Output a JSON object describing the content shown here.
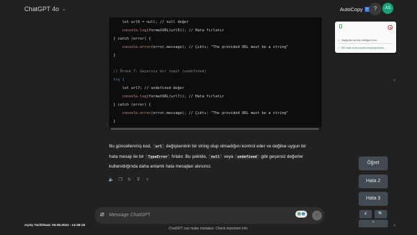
{
  "header": {
    "model_label": "ChatGPT 4o",
    "autocopy_label": "AutoCopy",
    "help_label": "?",
    "avatar_initials": "AS"
  },
  "popup": {
    "item1": "Aşağıda vermiş olduğun kod...",
    "item2": "Bir hata durumunda karşılaşılacak..."
  },
  "code": {
    "l1": "    let url6 = null; // null değer",
    "l2a": "    console",
    "l2b": ".log",
    "l2c": "(formatURL(url6)); // Hata fırlatır",
    "l3": "} catch (error) {",
    "l4a": "    console",
    "l4b": ".error",
    "l4c": "(error.message); // Çıktı: \"The provided URL must be a string\"",
    "l5": "}",
    "l6": "// Örnek 7: Geçersiz bir input (undefined)",
    "l7": "try {",
    "l8": "    let url7; // undefined değer",
    "l9a": "    console",
    "l9b": ".log",
    "l9c": "(formatURL(url7)); // Hata fırlatır",
    "l10": "} catch (error) {",
    "l11a": "    console",
    "l11b": ".error",
    "l11c": "(error.message); // Çıktı: \"The provided URL must be a string\"",
    "l12": "}"
  },
  "answer": {
    "l1a": "Bu güncellenmiş kod, ",
    "l1code": "`url`",
    "l1b": " değişkeninin bir string olup olmadığını kontrol eder ve değilse uygun bir",
    "l2a": "hata mesajı ile bir ",
    "l2code": "`TypeError`",
    "l2b": " fırlatır. Bu şekilde, ",
    "l2code2": "`null`",
    "l2c": " veya ",
    "l2code3": "`undefined`",
    "l2d": " gibi geçersiz değerler",
    "l3": "kullanıldığında daha anlamlı hata mesajları alırsınız."
  },
  "composer": {
    "placeholder": "Message ChatGPT"
  },
  "footer": {
    "disclaimer": "ChatGPT can make mistakes. Check important info.",
    "saved_time": "Açılış Tarih/Saat: 05.08.2024 - 14:38:18"
  },
  "side_panel": {
    "btn1": "Öğret",
    "btn2": "Hata 2",
    "btn3": "Hata 3",
    "mini1": "#",
    "mini2": "🔍",
    "up": "^"
  },
  "colors": {
    "background": "#212121",
    "code_background": "#0d0d0d",
    "side_button": "#424a52",
    "avatar": "#16a37a"
  }
}
